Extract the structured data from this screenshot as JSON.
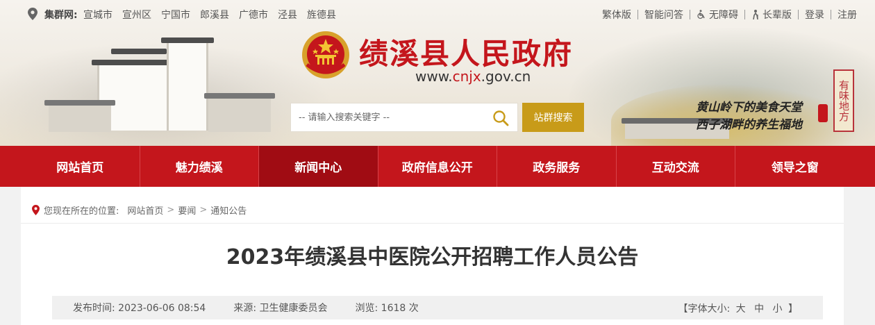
{
  "topbar": {
    "cluster_label": "集群网:",
    "cluster_links": [
      "宣城市",
      "宣州区",
      "宁国市",
      "郎溪县",
      "广德市",
      "泾县",
      "旌德县"
    ],
    "right_links": [
      "繁体版",
      "智能问答",
      "无障碍",
      "长辈版",
      "登录",
      "注册"
    ]
  },
  "site": {
    "title": "绩溪县人民政府",
    "url_prefix": "www.",
    "url_highlight": "cnjx",
    "url_suffix": ".gov.cn"
  },
  "search": {
    "placeholder": "-- 请输入搜索关键字 --",
    "button_label": "站群搜索"
  },
  "slogan": {
    "line1": "黄山岭下的美食天堂",
    "line2": "西子湖畔的养生福地",
    "seal_text": "有味地方"
  },
  "nav": {
    "items": [
      {
        "label": "网站首页",
        "active": false
      },
      {
        "label": "魅力绩溪",
        "active": false
      },
      {
        "label": "新闻中心",
        "active": true
      },
      {
        "label": "政府信息公开",
        "active": false
      },
      {
        "label": "政务服务",
        "active": false
      },
      {
        "label": "互动交流",
        "active": false
      },
      {
        "label": "领导之窗",
        "active": false
      }
    ]
  },
  "breadcrumb": {
    "prefix": "您现在所在的位置:",
    "items": [
      "网站首页",
      "要闻",
      "通知公告"
    ],
    "separator": ">"
  },
  "article": {
    "title": "2023年绩溪县中医院公开招聘工作人员公告",
    "published": "发布时间: 2023-06-06 08:54",
    "source": "来源: 卫生健康委员会",
    "views": "浏览: 1618 次",
    "font_size_label": "【字体大小:",
    "font_size_options": [
      "大",
      "中",
      "小"
    ],
    "font_size_close": "】"
  },
  "colors": {
    "brand_red": "#c4161c",
    "nav_active": "#a00c13",
    "search_button": "#c89b19"
  }
}
